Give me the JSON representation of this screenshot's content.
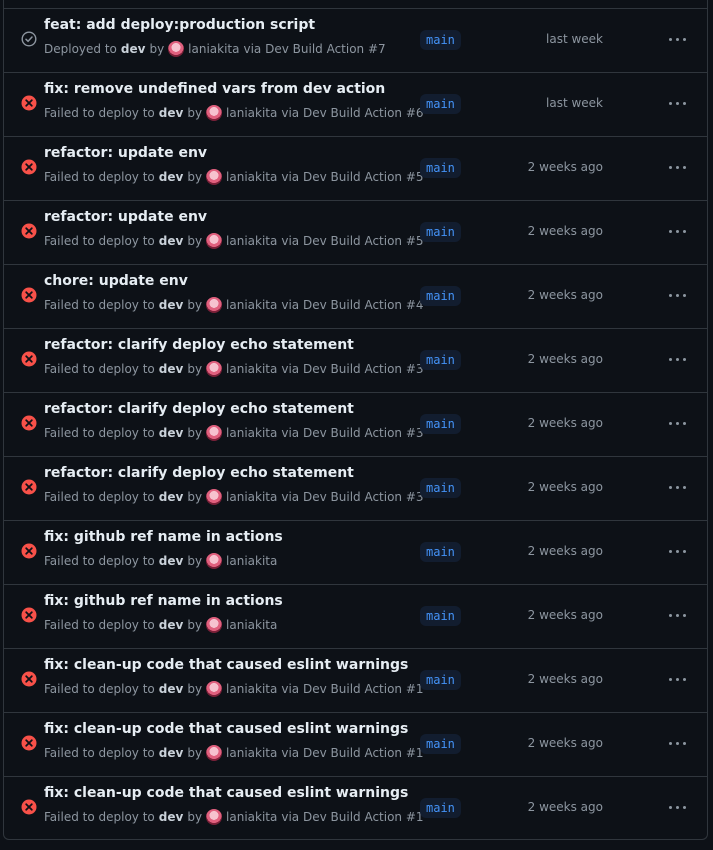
{
  "rows": [
    {
      "title": "feat: add deploy:production script",
      "status": "success",
      "prefix": "Deployed to",
      "env": "dev",
      "by": "by",
      "actor": "laniakita",
      "via": "via Dev Build Action #7",
      "branch": "main",
      "time": "last week"
    },
    {
      "title": "fix: remove undefined vars from dev action",
      "status": "failure",
      "prefix": "Failed to deploy to",
      "env": "dev",
      "by": "by",
      "actor": "laniakita",
      "via": "via Dev Build Action #6",
      "branch": "main",
      "time": "last week"
    },
    {
      "title": "refactor: update env",
      "status": "failure",
      "prefix": "Failed to deploy to",
      "env": "dev",
      "by": "by",
      "actor": "laniakita",
      "via": "via Dev Build Action #5",
      "branch": "main",
      "time": "2 weeks ago"
    },
    {
      "title": "refactor: update env",
      "status": "failure",
      "prefix": "Failed to deploy to",
      "env": "dev",
      "by": "by",
      "actor": "laniakita",
      "via": "via Dev Build Action #5",
      "branch": "main",
      "time": "2 weeks ago"
    },
    {
      "title": "chore: update env",
      "status": "failure",
      "prefix": "Failed to deploy to",
      "env": "dev",
      "by": "by",
      "actor": "laniakita",
      "via": "via Dev Build Action #4",
      "branch": "main",
      "time": "2 weeks ago"
    },
    {
      "title": "refactor: clarify deploy echo statement",
      "status": "failure",
      "prefix": "Failed to deploy to",
      "env": "dev",
      "by": "by",
      "actor": "laniakita",
      "via": "via Dev Build Action #3",
      "branch": "main",
      "time": "2 weeks ago"
    },
    {
      "title": "refactor: clarify deploy echo statement",
      "status": "failure",
      "prefix": "Failed to deploy to",
      "env": "dev",
      "by": "by",
      "actor": "laniakita",
      "via": "via Dev Build Action #3",
      "branch": "main",
      "time": "2 weeks ago"
    },
    {
      "title": "refactor: clarify deploy echo statement",
      "status": "failure",
      "prefix": "Failed to deploy to",
      "env": "dev",
      "by": "by",
      "actor": "laniakita",
      "via": "via Dev Build Action #3",
      "branch": "main",
      "time": "2 weeks ago"
    },
    {
      "title": "fix: github ref name in actions",
      "status": "failure",
      "prefix": "Failed to deploy to",
      "env": "dev",
      "by": "by",
      "actor": "laniakita",
      "via": "",
      "branch": "main",
      "time": "2 weeks ago"
    },
    {
      "title": "fix: github ref name in actions",
      "status": "failure",
      "prefix": "Failed to deploy to",
      "env": "dev",
      "by": "by",
      "actor": "laniakita",
      "via": "",
      "branch": "main",
      "time": "2 weeks ago"
    },
    {
      "title": "fix: clean-up code that caused eslint warnings",
      "status": "failure",
      "prefix": "Failed to deploy to",
      "env": "dev",
      "by": "by",
      "actor": "laniakita",
      "via": "via Dev Build Action #1",
      "branch": "main",
      "time": "2 weeks ago"
    },
    {
      "title": "fix: clean-up code that caused eslint warnings",
      "status": "failure",
      "prefix": "Failed to deploy to",
      "env": "dev",
      "by": "by",
      "actor": "laniakita",
      "via": "via Dev Build Action #1",
      "branch": "main",
      "time": "2 weeks ago"
    },
    {
      "title": "fix: clean-up code that caused eslint warnings",
      "status": "failure",
      "prefix": "Failed to deploy to",
      "env": "dev",
      "by": "by",
      "actor": "laniakita",
      "via": "via Dev Build Action #1",
      "branch": "main",
      "time": "2 weeks ago"
    }
  ],
  "icons": {
    "success": "check-circle-icon",
    "failure": "x-circle-fill-icon",
    "more": "kebab-horizontal-icon"
  },
  "colors": {
    "failure": "#f85149",
    "success": "#8d96a0",
    "branch": "#4493f8"
  }
}
